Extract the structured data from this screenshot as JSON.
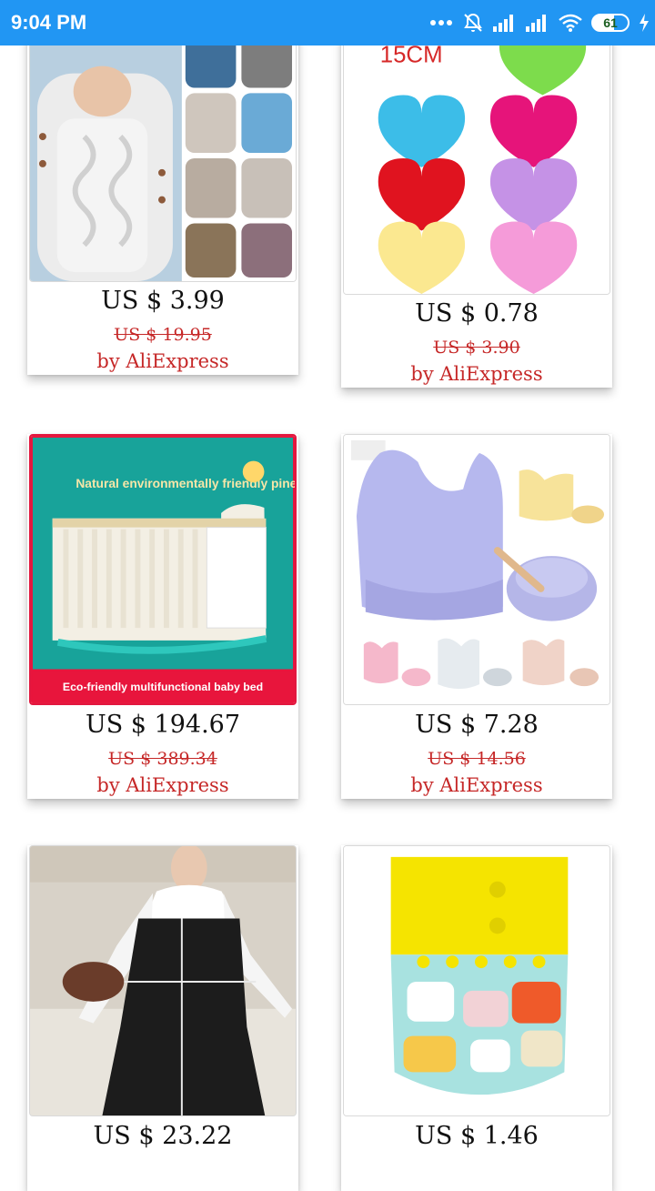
{
  "status_bar": {
    "time": "9:04 PM",
    "battery": "61",
    "icons": [
      "more-dots-icon",
      "mute-icon",
      "signal-icon",
      "signal-icon",
      "wifi-icon",
      "battery-icon",
      "charging-icon"
    ]
  },
  "products": [
    {
      "name": "Knitted baby sleeping bag",
      "price": "US $ 3.99",
      "original_price": "US $ 19.95",
      "seller": "by AliExpress",
      "image_icon": "baby-sleeping-bag-image"
    },
    {
      "name": "Heart silicone pads",
      "price": "US $ 0.78",
      "original_price": "US $ 3.90",
      "seller": "by AliExpress",
      "image_icon": "hearts-image",
      "image_text": "15CM"
    },
    {
      "name": "Baby bed",
      "price": "US $ 194.67",
      "original_price": "US $ 389.34",
      "seller": "by AliExpress",
      "image_icon": "baby-crib-image",
      "image_text": "Natural environmentally friendly pine",
      "image_banner": "Eco-friendly multifunctional baby bed"
    },
    {
      "name": "Silicone bib set",
      "price": "US $ 7.28",
      "original_price": "US $ 14.56",
      "seller": "by AliExpress",
      "image_icon": "baby-bib-image"
    },
    {
      "name": "Maternity dress",
      "price": "US $ 23.22",
      "original_price": "",
      "seller": "",
      "image_icon": "dress-image"
    },
    {
      "name": "Cloth diaper",
      "price": "US $ 1.46",
      "original_price": "",
      "seller": "",
      "image_icon": "diaper-image"
    }
  ],
  "colors": {
    "status_bar": "#2196f3",
    "old_price": "#c62828",
    "seller": "#c62828"
  }
}
